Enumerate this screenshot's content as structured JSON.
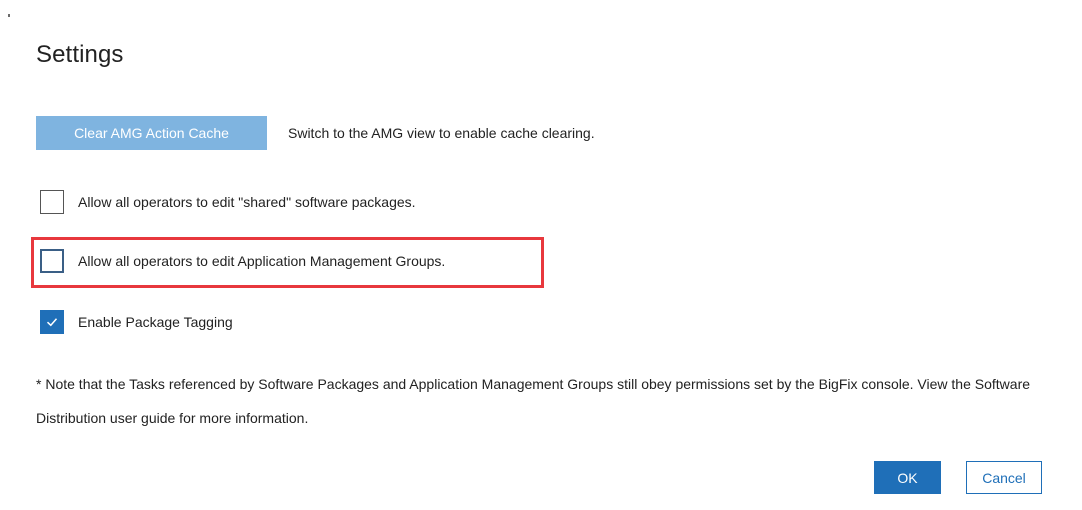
{
  "dialog": {
    "title": "Settings"
  },
  "cache": {
    "button_label": "Clear AMG Action Cache",
    "hint": "Switch to the AMG view to enable cache clearing.",
    "button_color": "#7fb4e0"
  },
  "options": [
    {
      "label": "Allow all operators to edit \"shared\" software packages.",
      "checked": false
    },
    {
      "label": "Allow all operators to edit Application Management Groups.",
      "checked": false,
      "highlighted": true
    },
    {
      "label": "Enable Package Tagging",
      "checked": true
    }
  ],
  "note": {
    "text": "* Note that the Tasks referenced by Software Packages and Application Management Groups still obey permissions set by the BigFix console. View the Software Distribution user guide for more information."
  },
  "footer": {
    "ok_label": "OK",
    "cancel_label": "Cancel"
  },
  "colors": {
    "accent": "#1f6fb8",
    "highlight_border": "#e8383d"
  },
  "icons": {
    "checked": "checkmark-icon"
  }
}
